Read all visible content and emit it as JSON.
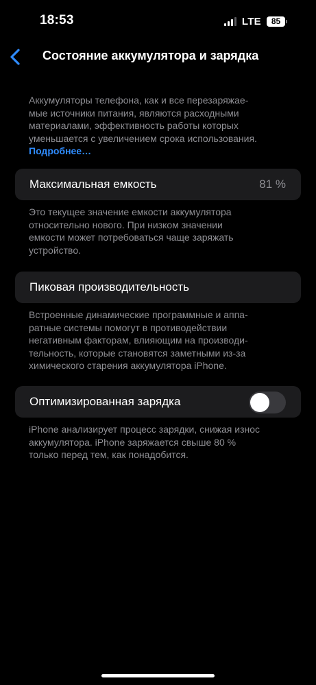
{
  "status_bar": {
    "time": "18:53",
    "network": "LTE",
    "battery_level": "85",
    "signal_bars_active": 3,
    "signal_bars_total": 4
  },
  "nav": {
    "back_icon": "chevron-left-icon",
    "title": "Состояние аккумулятора и зарядка"
  },
  "intro": {
    "lines": [
      "Аккумуляторы телефона, как и все перезаряжае-",
      "мые источники питания, являются расходными",
      "материалами, эффективность работы которых",
      "уменьшается с увеличением срока использования."
    ],
    "more_link": "Подробнее…"
  },
  "max_capacity": {
    "label": "Максимальная емкость",
    "value": "81 %",
    "description_lines": [
      "Это текущее значение емкости аккумулятора",
      "относительно нового. При низком значении",
      "емкости может потребоваться чаще заряжать",
      "устройство."
    ]
  },
  "peak_performance": {
    "label": "Пиковая производительность",
    "description_lines": [
      "Встроенные динамические программные и аппа-",
      "ратные системы помогут в противодействии",
      "негативным факторам, влияющим на производи-",
      "тельность, которые становятся заметными из-за",
      "химического старения аккумулятора iPhone."
    ]
  },
  "optimized_charging": {
    "label": "Оптимизированная зарядка",
    "enabled": false,
    "description_lines": [
      "iPhone анализирует процесс зарядки, снижая износ",
      "аккумулятора. iPhone заряжается свыше 80 %",
      "только перед тем, как понадобится."
    ]
  },
  "colors": {
    "background": "#000000",
    "card": "#1c1c1e",
    "secondary_text": "#8e8e93",
    "accent": "#2f8cff",
    "toggle_off": "#39393d"
  }
}
